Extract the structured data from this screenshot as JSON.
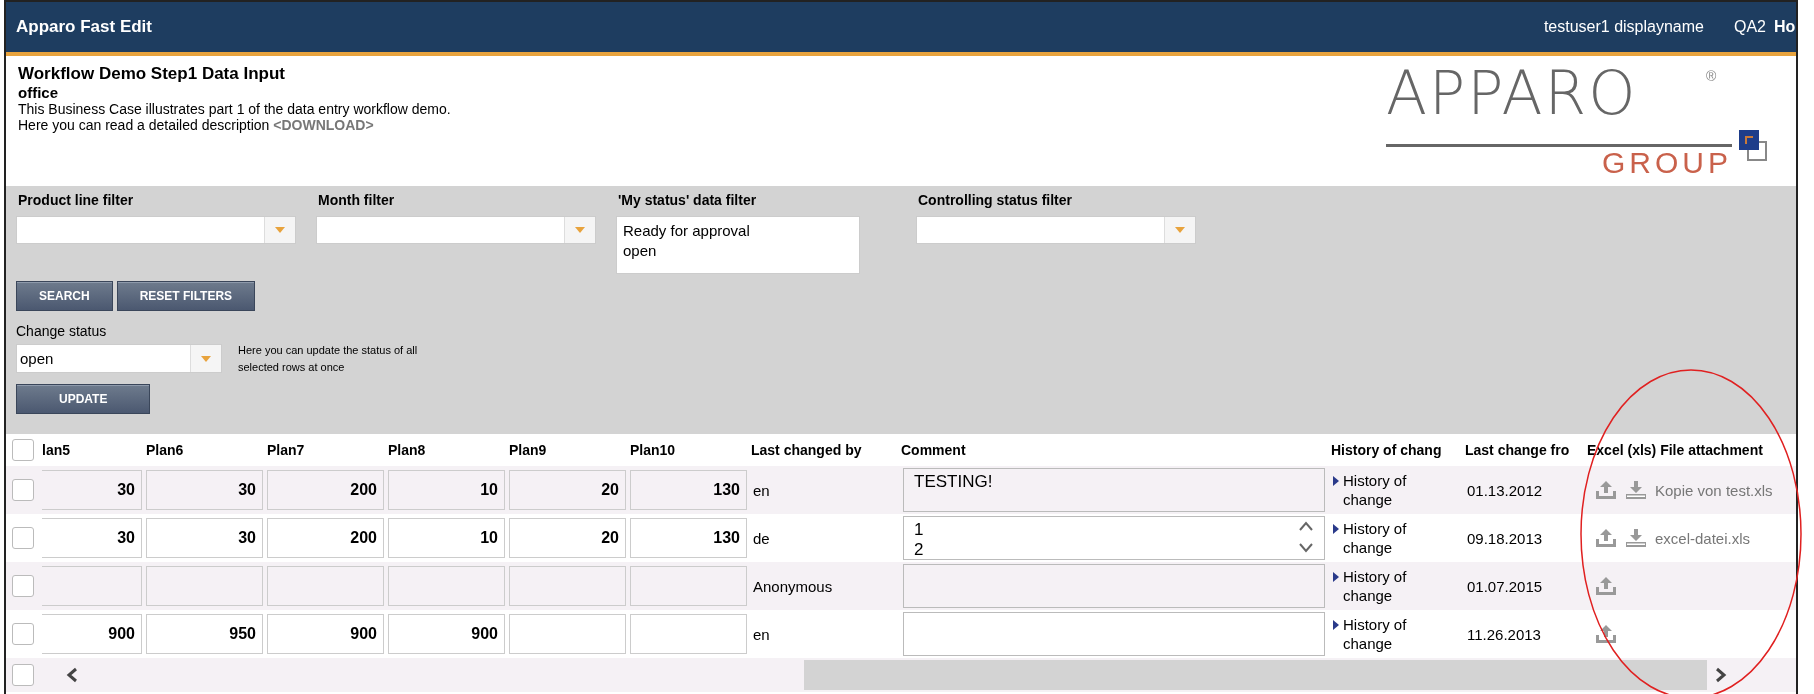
{
  "header": {
    "title": "Apparo Fast Edit",
    "user": "testuser1 displayname",
    "environment": "QA2",
    "nav_item": "Ho"
  },
  "page": {
    "title": "Workflow Demo Step1 Data Input",
    "subtitle": "office",
    "description": "This Business Case illustrates part 1 of the data entry workflow demo.",
    "download_prompt": "Here you can read a detailed description",
    "download_link": "<DOWNLOAD>"
  },
  "logo": {
    "wordmark": "APPARO",
    "registered": "®",
    "group": "GROUP"
  },
  "filters": [
    {
      "label": "Product line filter",
      "kind": "dropdown"
    },
    {
      "label": "Month filter",
      "kind": "dropdown"
    },
    {
      "label": "'My status' data filter",
      "kind": "multiselect",
      "options": [
        "Ready for approval",
        "open"
      ]
    },
    {
      "label": "Controlling status filter",
      "kind": "dropdown"
    }
  ],
  "filter_buttons": [
    "SEARCH",
    "RESET FILTERS"
  ],
  "change_status": {
    "label": "Change status",
    "value": "open",
    "hint": "Here you can update the status of all selected rows at once",
    "button": "UPDATE"
  },
  "table": {
    "select_all_checked": false,
    "columns": [
      "lan5",
      "Plan6",
      "Plan7",
      "Plan8",
      "Plan9",
      "Plan10",
      "Last changed by",
      "Comment",
      "History of chang",
      "Last change fro",
      "Excel (xls) File attachment"
    ],
    "rows": [
      {
        "checked": false,
        "plans": {
          "plan5": "30",
          "plan6": "30",
          "plan7": "200",
          "plan8": "10",
          "plan9": "20",
          "plan10": "130"
        },
        "last_changed_by": "en",
        "comment": "TESTING!",
        "comment_scrollbar": false,
        "history": "History of change",
        "last_change": "01.13.2012",
        "file": "Kopie von test.xls"
      },
      {
        "checked": false,
        "plans": {
          "plan5": "30",
          "plan6": "30",
          "plan7": "200",
          "plan8": "10",
          "plan9": "20",
          "plan10": "130"
        },
        "last_changed_by": "de",
        "comment": "1\n2",
        "comment_scrollbar": true,
        "history": "History of change",
        "last_change": "09.18.2013",
        "file": "excel-datei.xls"
      },
      {
        "checked": false,
        "last_changed_by": "Anonymous",
        "comment_scrollbar": false,
        "history": "History of change",
        "last_change": "01.07.2015"
      },
      {
        "checked": false,
        "plans": {
          "plan5": "900",
          "plan6": "950",
          "plan7": "900",
          "plan8": "900"
        },
        "last_changed_by": "en",
        "comment_scrollbar": false,
        "history": "History of change",
        "last_change": "11.26.2013"
      }
    ],
    "next_row_checked": false
  }
}
